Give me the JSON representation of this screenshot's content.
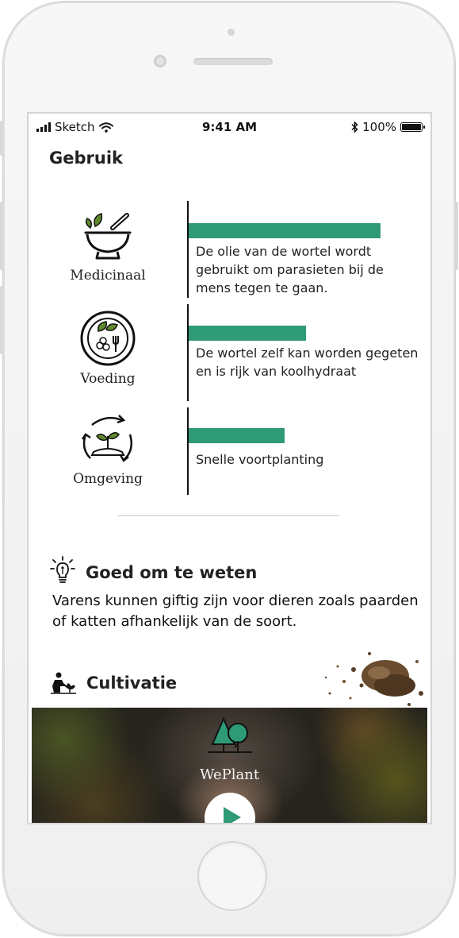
{
  "status_bar": {
    "carrier": "Sketch",
    "time": "9:41 AM",
    "battery_percent": "100%"
  },
  "uses": {
    "title": "Gebruik",
    "accent_color": "#2f9a76",
    "items": [
      {
        "label": "Medicinaal",
        "icon": "mortar-pestle-icon",
        "level": 1.0,
        "description": "De olie van de wortel wordt gebruikt om parasieten bij de mens tegen te gaan."
      },
      {
        "label": "Voeding",
        "icon": "plate-fork-icon",
        "level": 0.61,
        "description": "De wortel zelf kan worden gegeten en is rijk van koolhydraat"
      },
      {
        "label": "Omgeving",
        "icon": "plant-cycle-icon",
        "level": 0.5,
        "description": "Snelle voortplanting"
      }
    ]
  },
  "good_to_know": {
    "title": "Goed om te weten",
    "icon": "lightbulb-idea-icon",
    "text": "Varens kunnen giftig zijn voor dieren zoals paarden of katten afhankelijk van de soort."
  },
  "cultivation": {
    "title": "Cultivatie",
    "icon": "gardener-icon"
  },
  "video": {
    "brand": "WePlant",
    "logo_icon": "trees-logo-icon",
    "play_icon": "play-icon"
  }
}
